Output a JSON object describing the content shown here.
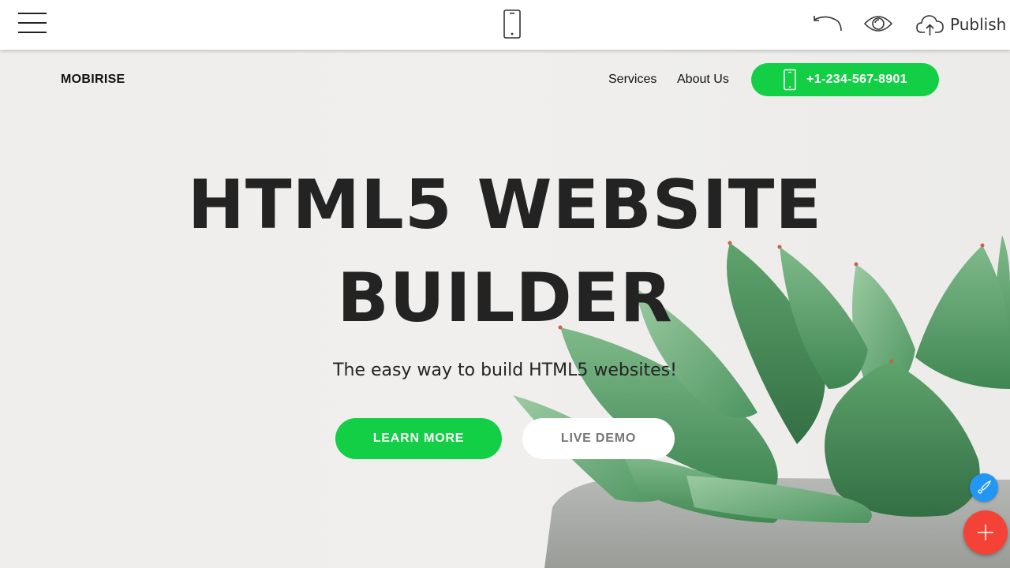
{
  "toolbar": {
    "menu_icon": "hamburger-menu-icon",
    "device_icon": "mobile-device-icon",
    "undo_icon": "undo-icon",
    "preview_icon": "eye-icon",
    "publish_icon": "cloud-upload-icon",
    "publish_label": "Publish"
  },
  "site": {
    "brand": "MOBIRISE",
    "nav": [
      {
        "label": "Services"
      },
      {
        "label": "About Us"
      }
    ],
    "phone_button": {
      "icon": "mobile-phone-icon",
      "label": "+1-234-567-8901"
    },
    "hero": {
      "title_line1": "HTML5 WEBSITE",
      "title_line2": "BUILDER",
      "subtitle": "The easy way to build HTML5 websites!",
      "primary_button": "LEARN MORE",
      "secondary_button": "LIVE DEMO"
    }
  },
  "floating_actions": {
    "edit_icon": "paintbrush-icon",
    "add_icon": "plus-icon"
  },
  "colors": {
    "accent_green": "#13cf45",
    "fab_blue": "#2196f3",
    "fab_red": "#f44336",
    "text_dark": "#232323"
  }
}
